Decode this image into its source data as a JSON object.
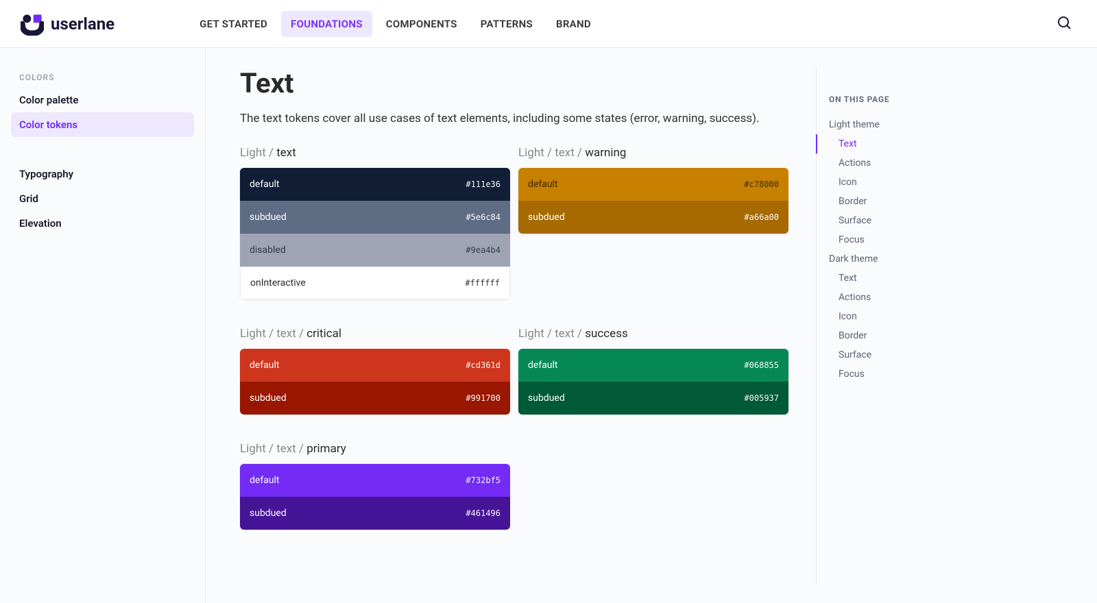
{
  "brand": {
    "name": "userlane"
  },
  "nav": {
    "items": [
      {
        "label": "GET STARTED",
        "active": false
      },
      {
        "label": "FOUNDATIONS",
        "active": true
      },
      {
        "label": "COMPONENTS",
        "active": false
      },
      {
        "label": "PATTERNS",
        "active": false
      },
      {
        "label": "BRAND",
        "active": false
      }
    ]
  },
  "sidebar": {
    "section_title": "COLORS",
    "color_items": [
      {
        "label": "Color palette",
        "active": false
      },
      {
        "label": "Color tokens",
        "active": true
      }
    ],
    "other_items": [
      {
        "label": "Typography"
      },
      {
        "label": "Grid"
      },
      {
        "label": "Elevation"
      }
    ]
  },
  "page": {
    "title": "Text",
    "intro": "The text tokens cover all use cases of text elements, including some states (error, warning, success)."
  },
  "token_groups": [
    {
      "path_prefix": "Light / ",
      "path_last": "text",
      "col": 0,
      "swatches": [
        {
          "name": "default",
          "hex": "#111e36",
          "bg": "#111e36",
          "fg": "#ffffff"
        },
        {
          "name": "subdued",
          "hex": "#5e6c84",
          "bg": "#5e6c84",
          "fg": "#ffffff"
        },
        {
          "name": "disabled",
          "hex": "#9ea4b4",
          "bg": "#9ea4b4",
          "fg": "#33394a"
        },
        {
          "name": "onInteractive",
          "hex": "#ffffff",
          "bg": "#ffffff",
          "fg": "#2a2a2a",
          "border": true
        }
      ]
    },
    {
      "path_prefix": "Light / text / ",
      "path_last": "warning",
      "col": 1,
      "swatches": [
        {
          "name": "default",
          "hex": "#c78000",
          "bg": "#c78000",
          "fg": "#3a2600"
        },
        {
          "name": "subdued",
          "hex": "#a66a00",
          "bg": "#a66a00",
          "fg": "#ffffff"
        }
      ]
    },
    {
      "path_prefix": "Light / text / ",
      "path_last": "critical",
      "col": 0,
      "swatches": [
        {
          "name": "default",
          "hex": "#cd361d",
          "bg": "#cd361d",
          "fg": "#ffffff"
        },
        {
          "name": "subdued",
          "hex": "#991700",
          "bg": "#991700",
          "fg": "#ffffff"
        }
      ]
    },
    {
      "path_prefix": "Light / text / ",
      "path_last": "success",
      "col": 1,
      "swatches": [
        {
          "name": "default",
          "hex": "#068855",
          "bg": "#068855",
          "fg": "#ffffff"
        },
        {
          "name": "subdued",
          "hex": "#005937",
          "bg": "#005937",
          "fg": "#ffffff"
        }
      ]
    },
    {
      "path_prefix": "Light / text / ",
      "path_last": "primary",
      "col": 0,
      "swatches": [
        {
          "name": "default",
          "hex": "#732bf5",
          "bg": "#732bf5",
          "fg": "#ffffff"
        },
        {
          "name": "subdued",
          "hex": "#461496",
          "bg": "#461496",
          "fg": "#ffffff"
        }
      ]
    }
  ],
  "toc": {
    "title": "ON THIS PAGE",
    "items": [
      {
        "label": "Light theme",
        "level": 1,
        "active": false
      },
      {
        "label": "Text",
        "level": 2,
        "active": true
      },
      {
        "label": "Actions",
        "level": 2,
        "active": false
      },
      {
        "label": "Icon",
        "level": 2,
        "active": false
      },
      {
        "label": "Border",
        "level": 2,
        "active": false
      },
      {
        "label": "Surface",
        "level": 2,
        "active": false
      },
      {
        "label": "Focus",
        "level": 2,
        "active": false
      },
      {
        "label": "Dark theme",
        "level": 1,
        "active": false
      },
      {
        "label": "Text",
        "level": 2,
        "active": false
      },
      {
        "label": "Actions",
        "level": 2,
        "active": false
      },
      {
        "label": "Icon",
        "level": 2,
        "active": false
      },
      {
        "label": "Border",
        "level": 2,
        "active": false
      },
      {
        "label": "Surface",
        "level": 2,
        "active": false
      },
      {
        "label": "Focus",
        "level": 2,
        "active": false
      }
    ]
  }
}
